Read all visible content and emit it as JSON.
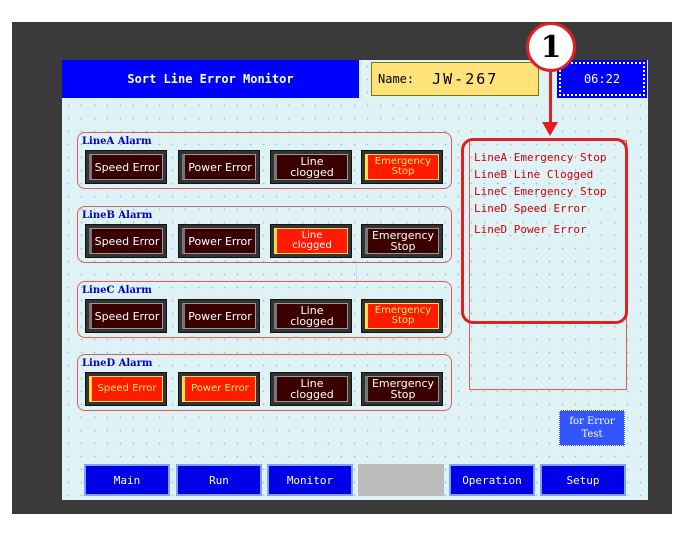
{
  "header": {
    "title": "Sort Line Error Monitor",
    "name_label": "Name:",
    "name_value": "JW-267",
    "clock": "06:22"
  },
  "callout": {
    "number": "1"
  },
  "groups": [
    {
      "label": "LineA Alarm",
      "buttons": [
        {
          "label": "Speed Error",
          "active": false
        },
        {
          "label": "Power Error",
          "active": false
        },
        {
          "label": "Line\nclogged",
          "active": false
        },
        {
          "label": "Emergency\nStop",
          "active": true
        }
      ]
    },
    {
      "label": "LineB Alarm",
      "buttons": [
        {
          "label": "Speed Error",
          "active": false
        },
        {
          "label": "Power Error",
          "active": false
        },
        {
          "label": "Line\nclogged",
          "active": true
        },
        {
          "label": "Emergency\nStop",
          "active": false
        }
      ]
    },
    {
      "label": "LineC Alarm",
      "buttons": [
        {
          "label": "Speed Error",
          "active": false
        },
        {
          "label": "Power Error",
          "active": false
        },
        {
          "label": "Line\nclogged",
          "active": false
        },
        {
          "label": "Emergency\nStop",
          "active": true
        }
      ]
    },
    {
      "label": "LineD Alarm",
      "buttons": [
        {
          "label": "Speed Error",
          "active": true
        },
        {
          "label": "Power Error",
          "active": true
        },
        {
          "label": "Line\nclogged",
          "active": false
        },
        {
          "label": "Emergency\nStop",
          "active": false
        }
      ]
    }
  ],
  "error_log": [
    "LineA Emergency Stop",
    "LineB Line Clogged",
    "LineC Emergency Stop",
    "LineD Speed Error",
    "LineD Power Error"
  ],
  "test_button": {
    "line1": "for Error",
    "line2": "Test"
  },
  "nav": [
    "Main",
    "Run",
    "Monitor",
    "Operation",
    "Setup"
  ],
  "colors": {
    "alarm_on": "#ff1a00",
    "alarm_off": "#3a0000",
    "nav_blue": "#0000e6",
    "highlight_red": "#e02020"
  }
}
